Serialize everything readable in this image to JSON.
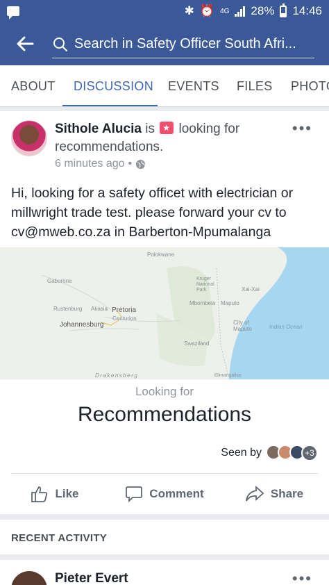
{
  "status_bar": {
    "battery": "28%",
    "battery_level": 0.28,
    "network": "4G",
    "time": "14:46"
  },
  "header": {
    "search_text": "Search in Safety Officer South Afri...",
    "back_icon": "arrow-left-icon",
    "search_icon": "search-icon"
  },
  "tabs": [
    {
      "label": "ABOUT"
    },
    {
      "label": "DISCUSSION",
      "active": true
    },
    {
      "label": "EVENTS"
    },
    {
      "label": "FILES"
    },
    {
      "label": "PHOTOS"
    }
  ],
  "post": {
    "author": "Sithole Alucia",
    "is_text": "is",
    "action_text": "looking for recommendations.",
    "time_ago": "6 minutes ago",
    "body": "Hi, looking for a safety officet with electrician or millwright trade test. please forward your cv to cv@mweb.co.za in Barberton-Mpumalanga",
    "map_labels": {
      "polokwane": "Polokwane",
      "gaborone": "Gaborone",
      "kruger": "Kruger National Park",
      "xai_xai": "Xai-Xai",
      "rustenburg": "Rustenburg",
      "akasia": "Akasia",
      "pretoria": "Pretoria",
      "centurion": "Centurion",
      "mbombela": "Mbombela",
      "maputo": "Maputo",
      "johannesburg": "Johannesburg",
      "city_of_maputo": "City of Maputo",
      "indian_ocean": "Indian Ocean",
      "swaziland": "Swaziland",
      "drakensberg": "Drakensberg",
      "simangaliso": "iSimangaliso"
    },
    "looking_for": "Looking for",
    "recommendations": "Recommendations",
    "seen_by": "Seen by",
    "seen_extra": "+3",
    "actions": {
      "like": "Like",
      "comment": "Comment",
      "share": "Share"
    }
  },
  "recent_activity": {
    "label": "RECENT ACTIVITY",
    "next_author": "Pieter Evert"
  },
  "colors": {
    "brand": "#3b5998",
    "tab_active": "#4267b2",
    "ocean": "#a7d7f0"
  }
}
